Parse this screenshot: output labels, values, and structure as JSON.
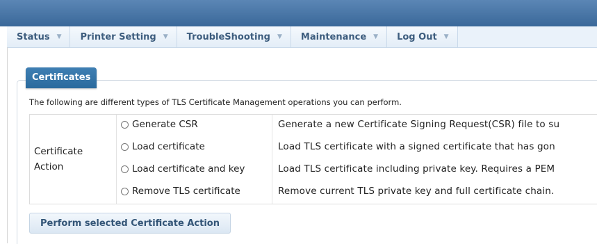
{
  "nav": {
    "items": [
      {
        "label": "Status",
        "caret": "▼"
      },
      {
        "label": "Printer Setting",
        "caret": "▼"
      },
      {
        "label": "TroubleShooting",
        "caret": "▼"
      },
      {
        "label": "Maintenance",
        "caret": "▼"
      },
      {
        "label": "Log Out",
        "caret": "▼"
      }
    ]
  },
  "panel": {
    "title": "Certificates",
    "intro": "The following are different types of TLS Certificate Management operations you can perform.",
    "row_label": "Certificate Action",
    "options": [
      {
        "label": "Generate CSR",
        "description": "Generate a new Certificate Signing Request(CSR) file to su"
      },
      {
        "label": "Load certificate",
        "description": "Load TLS certificate with a signed certificate that has gon"
      },
      {
        "label": "Load certificate and key",
        "description": "Load TLS certificate including private key. Requires a PEM"
      },
      {
        "label": "Remove TLS certificate",
        "description": "Remove current TLS private key and full certificate chain."
      }
    ],
    "action_button": "Perform selected Certificate Action"
  },
  "colors": {
    "header_blue": "#3a6899",
    "tab_blue": "#2a6a9d",
    "nav_bg": "#eaf2fa",
    "nav_text": "#3d5d7e"
  }
}
